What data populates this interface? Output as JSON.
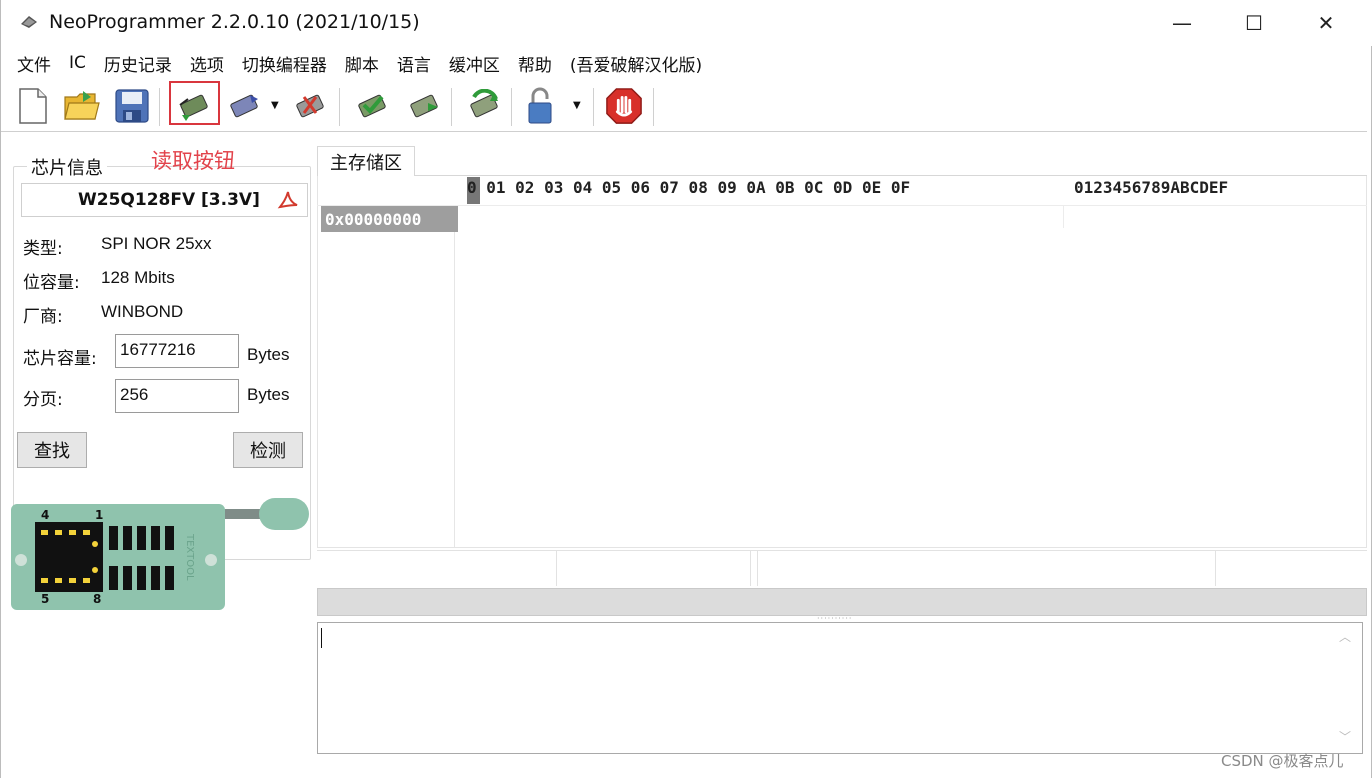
{
  "window": {
    "title": "NeoProgrammer 2.2.0.10 (2021/10/15)",
    "controls": {
      "minimize": "—",
      "maximize": "☐",
      "close": "✕"
    }
  },
  "menu": {
    "items": [
      "文件",
      "IC",
      "历史记录",
      "选项",
      "切换编程器",
      "脚本",
      "语言",
      "缓冲区",
      "帮助",
      "(吾爱破解汉化版)"
    ]
  },
  "toolbar": {
    "icons": [
      "new-file-icon",
      "open-folder-icon",
      "save-icon",
      "read-chip-icon",
      "write-chip-icon",
      "erase-chip-icon",
      "verify-chip-icon",
      "blank-check-icon",
      "auto-icon",
      "lock-icon",
      "stop-icon"
    ]
  },
  "annotation": {
    "text": "读取按钮",
    "color": "#e2434b"
  },
  "chip_info": {
    "group_title": "芯片信息",
    "chip_name": "W25Q128FV [3.3V]",
    "type_label": "类型:",
    "type_value": "SPI NOR 25xx",
    "bits_label": "位容量:",
    "bits_value": "128 Mbits",
    "vendor_label": "厂商:",
    "vendor_value": "WINBOND",
    "size_label": "芯片容量:",
    "size_value": "16777216",
    "size_unit": "Bytes",
    "page_label": "分页:",
    "page_value": "256",
    "page_unit": "Bytes",
    "find_button": "查找",
    "detect_button": "检测"
  },
  "socket": {
    "pin_labels": [
      "4",
      "1",
      "5",
      "8"
    ],
    "brand": "TEXTOOL",
    "color": "#8fc3ad"
  },
  "hex_view": {
    "tab_label": "主存储区",
    "header": "0 01 02 03 04 05 06 07 08 09 0A 0B 0C 0D 0E 0F",
    "ascii_header": "0123456789ABCDEF",
    "first_address": "0x00000000"
  },
  "watermark": "CSDN @极客点儿"
}
